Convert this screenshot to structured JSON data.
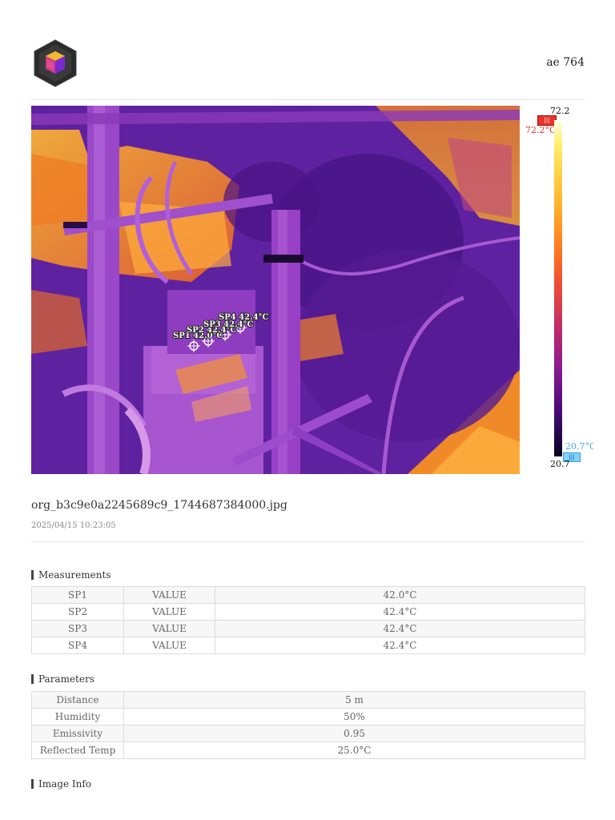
{
  "header": {
    "logo_icon": "cube-logo-icon",
    "device_name": "ae 764"
  },
  "thermal_image": {
    "spots": [
      {
        "label": "SP1 42.0°C"
      },
      {
        "label": "SP2 42.4°C"
      },
      {
        "label": "SP3 42.4°C"
      },
      {
        "label": "SP4 42.4°C"
      }
    ]
  },
  "color_scale": {
    "max": "72.2",
    "min": "20.7",
    "max_marker": "72.2°C",
    "min_marker": "20.7°C",
    "colors": [
      "#fffef0",
      "#ffd84a",
      "#ff7a20",
      "#c02a6a",
      "#4a0c78",
      "#0a0420"
    ]
  },
  "file": {
    "name": "org_b3c9e0a2245689c9_1744687384000.jpg",
    "datetime": "2025/04/15 10:23:05"
  },
  "measurements": {
    "title": "Measurements",
    "rows": [
      {
        "name": "SP1",
        "type": "VALUE",
        "value": "42.0°C"
      },
      {
        "name": "SP2",
        "type": "VALUE",
        "value": "42.4°C"
      },
      {
        "name": "SP3",
        "type": "VALUE",
        "value": "42.4°C"
      },
      {
        "name": "SP4",
        "type": "VALUE",
        "value": "42.4°C"
      }
    ]
  },
  "parameters": {
    "title": "Parameters",
    "rows": [
      {
        "name": "Distance",
        "value": "5 m"
      },
      {
        "name": "Humidity",
        "value": "50%"
      },
      {
        "name": "Emissivity",
        "value": "0.95"
      },
      {
        "name": "Reflected Temp",
        "value": "25.0°C"
      }
    ]
  },
  "image_info": {
    "title": "Image Info"
  }
}
